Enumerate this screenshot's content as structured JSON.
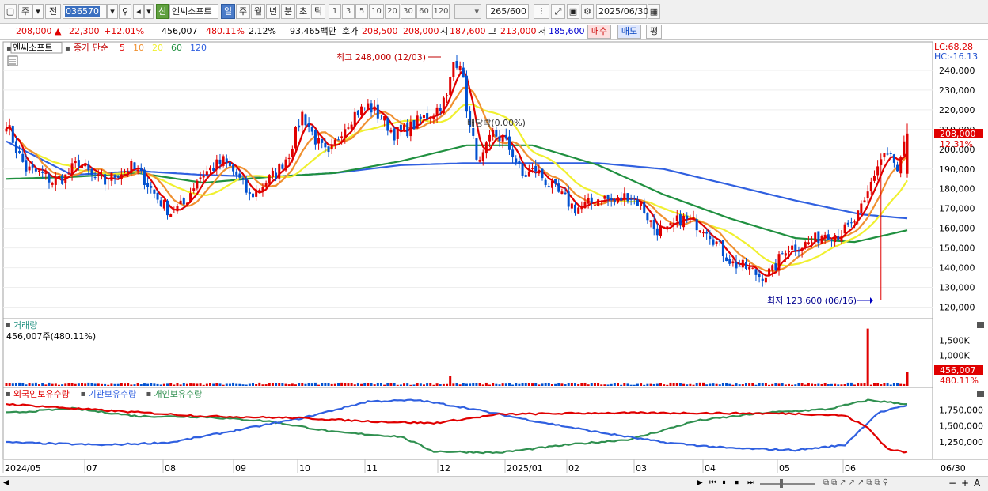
{
  "toolbar": {
    "mode_label": "주",
    "prefix_label": "전",
    "code_value": "036570",
    "new_badge": "신",
    "stock_name": "엔씨소프트",
    "periods": [
      "일",
      "주",
      "월",
      "년",
      "분",
      "초",
      "틱"
    ],
    "active_period": "일",
    "intervals": [
      "1",
      "3",
      "5",
      "10",
      "20",
      "30",
      "60",
      "120"
    ],
    "count_value": "265",
    "count_total": "/600",
    "date_value": "2025/06/30"
  },
  "quote": {
    "price": "208,000",
    "change": "22,300",
    "change_pct": "+12.01%",
    "volume": "456,007",
    "volume_ratio": "480.11%",
    "turnover_rate": "2.12%",
    "amount": "93,465백만",
    "ask_label": "호가",
    "ask_price": "208,500",
    "bid_price": "208,000",
    "open_label": "시",
    "open_price": "187,600",
    "high_label": "고",
    "high_price": "213,000",
    "low_label": "저",
    "low_price": "185,600",
    "buy_label": "매수",
    "sell_label": "매도",
    "eval_label": "평"
  },
  "legend": {
    "stock": "엔씨소프트",
    "ma_title": "종가 단순",
    "ma_periods": [
      "5",
      "10",
      "20",
      "60",
      "120"
    ],
    "ma_colors": [
      "#e00000",
      "#f09030",
      "#f0f030",
      "#209040",
      "#3060e0"
    ],
    "lc": "LC:68.28",
    "hc": "HC:-16.13",
    "current_price": "208,000",
    "current_pct": "12.31%"
  },
  "annotations": {
    "high": "최고 248,000 (12/03)",
    "low": "최저 123,600 (06/16)",
    "dividend": "배당락(0.00%)"
  },
  "volume_panel": {
    "title": "거래량",
    "summary": "456,007주(480.11%)",
    "ticks": [
      "1,500K",
      "1,000K",
      "500K"
    ],
    "badge_value": "456,007",
    "badge_pct": "480.11%"
  },
  "holdings_panel": {
    "titles": [
      "외국인보유수량",
      "기관보유수량",
      "개인보유수량"
    ],
    "colors": [
      "#e00000",
      "#3060e0",
      "#309050"
    ],
    "ticks": [
      "1,750,000",
      "1,500,000",
      "1,250,000"
    ]
  },
  "date_axis": [
    "2024/05",
    "07",
    "08",
    "09",
    "10",
    "11",
    "12",
    "2025/01",
    "02",
    "03",
    "04",
    "05",
    "06",
    "06/30"
  ],
  "chart_data": {
    "type": "candlestick",
    "title": "엔씨소프트",
    "y_ticks": [
      240000,
      230000,
      220000,
      210000,
      200000,
      190000,
      180000,
      170000,
      160000,
      150000,
      140000,
      130000,
      120000
    ],
    "ylim": [
      115000,
      252000
    ],
    "price_anchors": [
      [
        0,
        214000
      ],
      [
        3,
        200000
      ],
      [
        6,
        190000
      ],
      [
        10,
        188000
      ],
      [
        14,
        184000
      ],
      [
        18,
        186000
      ],
      [
        22,
        194000
      ],
      [
        26,
        186000
      ],
      [
        30,
        183000
      ],
      [
        34,
        188000
      ],
      [
        38,
        191000
      ],
      [
        42,
        185000
      ],
      [
        46,
        175000
      ],
      [
        50,
        168000
      ],
      [
        54,
        172000
      ],
      [
        58,
        185000
      ],
      [
        62,
        190000
      ],
      [
        66,
        194000
      ],
      [
        70,
        187000
      ],
      [
        74,
        176000
      ],
      [
        78,
        182000
      ],
      [
        82,
        188000
      ],
      [
        86,
        198000
      ],
      [
        90,
        218000
      ],
      [
        94,
        205000
      ],
      [
        98,
        196000
      ],
      [
        102,
        210000
      ],
      [
        106,
        218000
      ],
      [
        110,
        222000
      ],
      [
        114,
        216000
      ],
      [
        118,
        208000
      ],
      [
        122,
        210000
      ],
      [
        126,
        215000
      ],
      [
        130,
        219000
      ],
      [
        134,
        226000
      ],
      [
        136,
        244000
      ],
      [
        138,
        245000
      ],
      [
        141,
        210000
      ],
      [
        144,
        192000
      ],
      [
        148,
        208000
      ],
      [
        151,
        205000
      ],
      [
        154,
        198000
      ],
      [
        157,
        186000
      ],
      [
        161,
        190000
      ],
      [
        165,
        182000
      ],
      [
        169,
        176000
      ],
      [
        173,
        170000
      ],
      [
        177,
        172000
      ],
      [
        181,
        176000
      ],
      [
        185,
        173000
      ],
      [
        189,
        177000
      ],
      [
        193,
        172000
      ],
      [
        197,
        160000
      ],
      [
        201,
        158000
      ],
      [
        205,
        165000
      ],
      [
        209,
        163000
      ],
      [
        213,
        160000
      ],
      [
        217,
        150000
      ],
      [
        221,
        142000
      ],
      [
        225,
        140000
      ],
      [
        229,
        136000
      ],
      [
        233,
        138000
      ],
      [
        237,
        150000
      ],
      [
        241,
        151000
      ],
      [
        245,
        153000
      ],
      [
        249,
        158000
      ],
      [
        253,
        157000
      ],
      [
        257,
        161000
      ],
      [
        261,
        172000
      ],
      [
        263,
        183000
      ],
      [
        265,
        192000
      ],
      [
        267,
        198000
      ],
      [
        269,
        196000
      ],
      [
        271,
        188000
      ],
      [
        274,
        208000
      ]
    ],
    "ma60_anchors": [
      [
        0,
        185000
      ],
      [
        20,
        186000
      ],
      [
        40,
        188000
      ],
      [
        60,
        183000
      ],
      [
        80,
        186000
      ],
      [
        100,
        188000
      ],
      [
        120,
        194000
      ],
      [
        140,
        202000
      ],
      [
        160,
        202000
      ],
      [
        180,
        192000
      ],
      [
        200,
        177000
      ],
      [
        220,
        165000
      ],
      [
        240,
        155000
      ],
      [
        258,
        153000
      ],
      [
        274,
        159000
      ]
    ],
    "ma120_anchors": [
      [
        0,
        204000
      ],
      [
        20,
        187000
      ],
      [
        40,
        189000
      ],
      [
        60,
        187000
      ],
      [
        80,
        186000
      ],
      [
        100,
        188000
      ],
      [
        120,
        192000
      ],
      [
        140,
        193000
      ],
      [
        160,
        193000
      ],
      [
        180,
        193000
      ],
      [
        200,
        190000
      ],
      [
        220,
        182000
      ],
      [
        240,
        174000
      ],
      [
        260,
        167000
      ],
      [
        274,
        165000
      ]
    ],
    "high": {
      "value": 248000,
      "date": "12/03",
      "index": 137
    },
    "low": {
      "value": 123600,
      "date": "06/16",
      "index": 266
    },
    "last": {
      "open": 187600,
      "high": 213000,
      "low": 185600,
      "close": 208000
    },
    "volume": {
      "typical": 60000,
      "spike_index": 262,
      "spike_value": 1880000,
      "last_value": 456007
    },
    "holdings_ylim": [
      1000000,
      2050000
    ],
    "foreign_anchors": [
      [
        0,
        1840000
      ],
      [
        30,
        1740000
      ],
      [
        60,
        1650000
      ],
      [
        90,
        1620000
      ],
      [
        110,
        1570000
      ],
      [
        130,
        1540000
      ],
      [
        150,
        1680000
      ],
      [
        180,
        1700000
      ],
      [
        210,
        1700000
      ],
      [
        240,
        1690000
      ],
      [
        255,
        1660000
      ],
      [
        262,
        1470000
      ],
      [
        268,
        1140000
      ],
      [
        274,
        1080000
      ]
    ],
    "institution_anchors": [
      [
        0,
        1240000
      ],
      [
        30,
        1200000
      ],
      [
        50,
        1240000
      ],
      [
        70,
        1430000
      ],
      [
        90,
        1620000
      ],
      [
        110,
        1880000
      ],
      [
        125,
        1900000
      ],
      [
        140,
        1780000
      ],
      [
        160,
        1580000
      ],
      [
        180,
        1400000
      ],
      [
        200,
        1240000
      ],
      [
        220,
        1150000
      ],
      [
        240,
        1120000
      ],
      [
        255,
        1200000
      ],
      [
        265,
        1700000
      ],
      [
        274,
        1820000
      ]
    ],
    "individual_anchors": [
      [
        0,
        1700000
      ],
      [
        20,
        1770000
      ],
      [
        40,
        1650000
      ],
      [
        60,
        1640000
      ],
      [
        80,
        1570000
      ],
      [
        100,
        1400000
      ],
      [
        120,
        1330000
      ],
      [
        130,
        1100000
      ],
      [
        150,
        1080000
      ],
      [
        170,
        1200000
      ],
      [
        190,
        1290000
      ],
      [
        210,
        1580000
      ],
      [
        230,
        1700000
      ],
      [
        250,
        1760000
      ],
      [
        262,
        1900000
      ],
      [
        274,
        1840000
      ]
    ]
  }
}
